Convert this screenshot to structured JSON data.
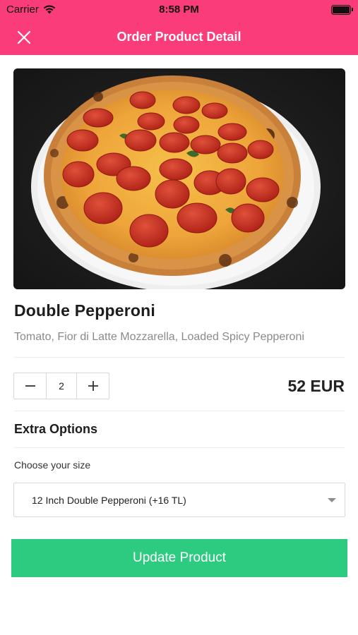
{
  "status_bar": {
    "carrier": "Carrier",
    "time": "8:58 PM"
  },
  "header": {
    "title": "Order Product Detail",
    "close_icon": "close-icon"
  },
  "product": {
    "image_icon": "pizza-photo",
    "name": "Double Pepperoni",
    "description": "Tomato, Fior di Latte Mozzarella, Loaded Spicy Pepperoni",
    "quantity": "2",
    "price": "52 EUR"
  },
  "extra_options": {
    "title": "Extra Options",
    "size_label": "Choose your size",
    "size_selected": "12 Inch Double Pepperoni (+16 TL)"
  },
  "actions": {
    "update_label": "Update Product"
  },
  "colors": {
    "header": "#fb3c7a",
    "cta": "#2ccb7f"
  }
}
